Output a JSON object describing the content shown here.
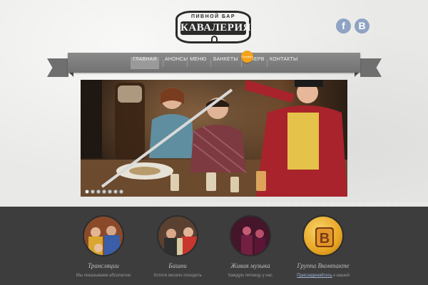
{
  "logo": {
    "subtitle": "ПИВНОЙ БАР",
    "name": "КАВАЛЕРИЯ"
  },
  "social": {
    "facebook": "f",
    "vkontakte": "B"
  },
  "nav": {
    "items": [
      {
        "label": "Главная",
        "active": true
      },
      {
        "label": "Анонсы"
      },
      {
        "label": "Меню"
      },
      {
        "label": "Банкеты"
      },
      {
        "label": "Резерв"
      },
      {
        "label": "Контакты"
      }
    ],
    "badge": "Онлайн"
  },
  "slider": {
    "slide_count": 7,
    "active_slide": 1
  },
  "features": [
    {
      "title": "Трансляции",
      "text": "Мы показываем абсолютно",
      "link": "",
      "icon": "tv-fans-photo-icon"
    },
    {
      "title": "Башни",
      "text": "Хотите весело посидеть",
      "link": "",
      "icon": "beer-tower-photo-icon"
    },
    {
      "title": "Живая музыка",
      "text": "Каждую пятницу у нас",
      "link": "",
      "icon": "live-music-photo-icon"
    },
    {
      "title": "Группа Вконтакте",
      "text": "к нашей",
      "link": "Присоединяйтесь",
      "icon": "vk-logo-icon"
    }
  ],
  "colors": {
    "nav_bg": "#7d7d7d",
    "badge": "#f4a21a",
    "band": "#3d3d3d",
    "vk_gold": "#e8a623"
  }
}
